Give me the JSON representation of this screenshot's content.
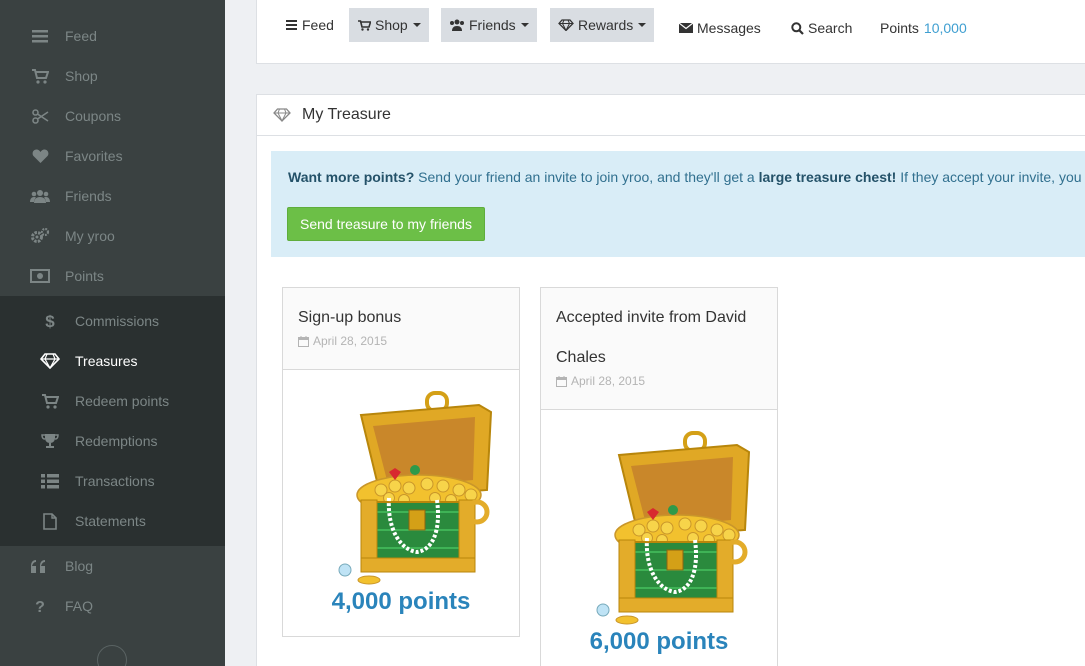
{
  "sidebar": {
    "items": [
      {
        "label": "Feed",
        "icon": "bars-icon"
      },
      {
        "label": "Shop",
        "icon": "cart-icon"
      },
      {
        "label": "Coupons",
        "icon": "scissors-icon"
      },
      {
        "label": "Favorites",
        "icon": "heart-icon"
      },
      {
        "label": "Friends",
        "icon": "users-icon"
      },
      {
        "label": "My yroo",
        "icon": "gears-icon"
      },
      {
        "label": "Points",
        "icon": "money-icon"
      }
    ],
    "subitems": [
      {
        "label": "Commissions",
        "icon": "dollar-icon"
      },
      {
        "label": "Treasures",
        "icon": "diamond-icon"
      },
      {
        "label": "Redeem points",
        "icon": "cart-icon"
      },
      {
        "label": "Redemptions",
        "icon": "trophy-icon"
      },
      {
        "label": "Transactions",
        "icon": "list-icon"
      },
      {
        "label": "Statements",
        "icon": "file-icon"
      }
    ],
    "after": [
      {
        "label": "Blog",
        "icon": "quote-icon"
      },
      {
        "label": "FAQ",
        "icon": "question-icon"
      }
    ]
  },
  "topnav": {
    "feed": "Feed",
    "shop": "Shop",
    "friends": "Friends",
    "rewards": "Rewards",
    "messages": "Messages",
    "search": "Search",
    "points_label": "Points",
    "points_value": "10,000"
  },
  "panel": {
    "title": "My Treasure",
    "alert": {
      "lead": "Want more points?",
      "text1": " Send your friend an invite to join yroo, and they'll get a ",
      "bold2": "large treasure chest!",
      "text2": " If they accept your invite, you"
    },
    "send_button": "Send treasure to my friends"
  },
  "cards": [
    {
      "title": "Sign-up bonus",
      "date": "April 28, 2015",
      "points": "4,000 points"
    },
    {
      "title": "Accepted invite from David Chales",
      "date": "April 28, 2015",
      "points": "6,000 points"
    }
  ],
  "colors": {
    "sidebar_bg": "#3a4141",
    "submenu_bg": "#2a3030",
    "accent": "#3f9fd1",
    "success": "#6cbf47",
    "points": "#2a84bb"
  }
}
